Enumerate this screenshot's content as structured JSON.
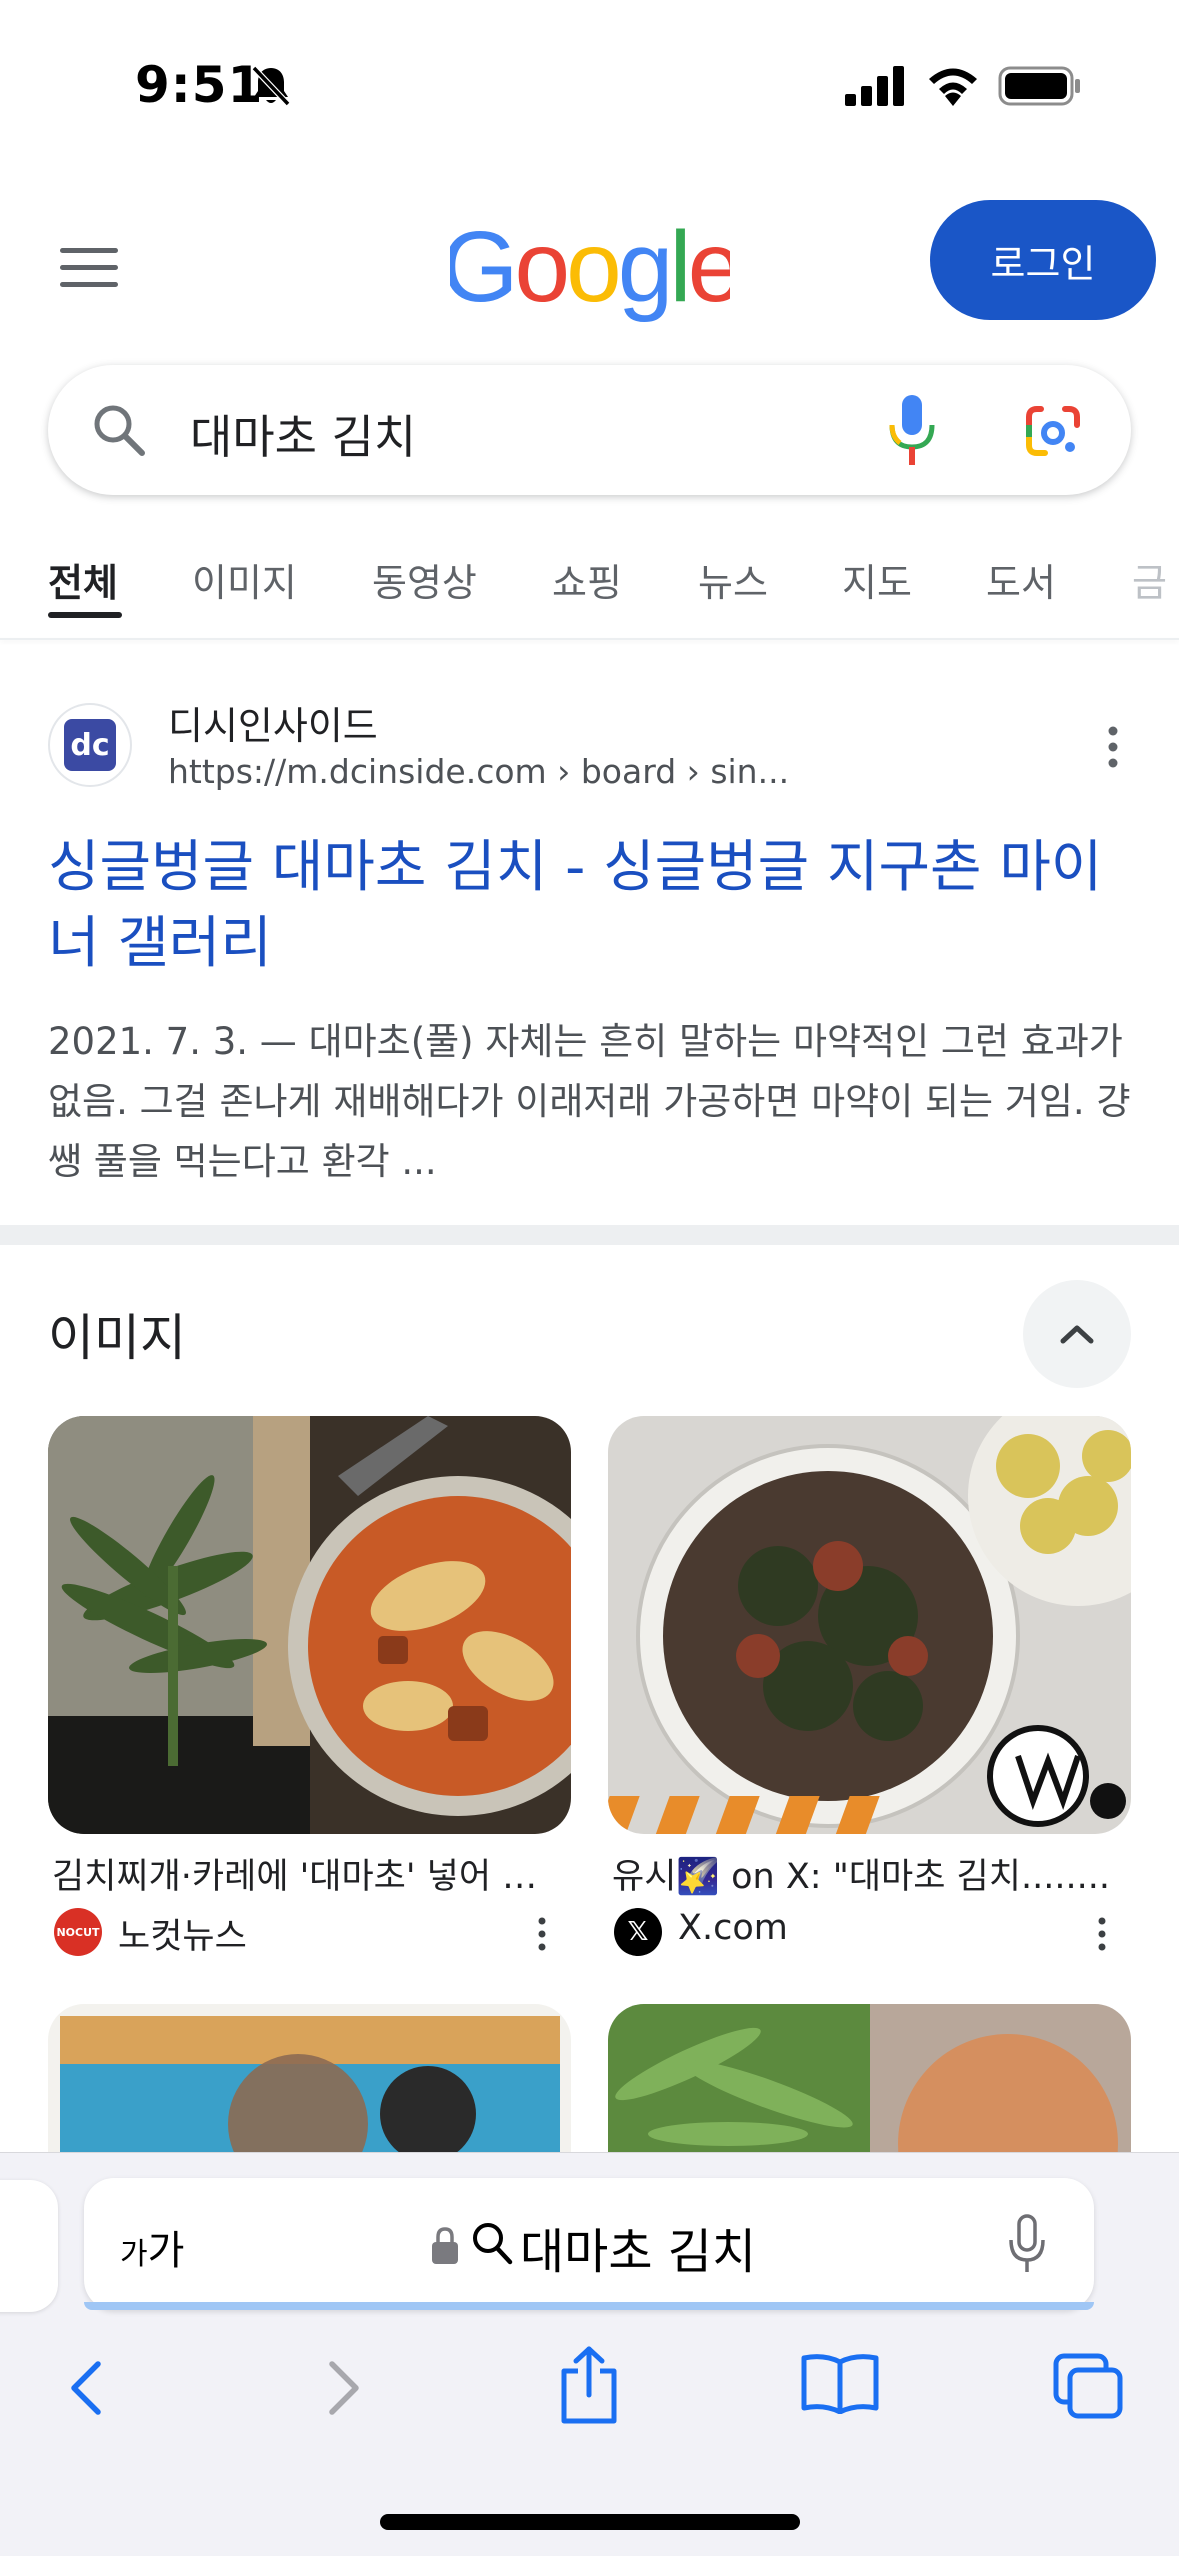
{
  "status": {
    "time": "9:51"
  },
  "header": {
    "logo_letters": [
      "G",
      "o",
      "o",
      "g",
      "l",
      "e"
    ],
    "logo_colors": [
      "#4285F4",
      "#EA4335",
      "#FBBC05",
      "#4285F4",
      "#34A853",
      "#EA4335"
    ],
    "login_label": "로그인"
  },
  "search": {
    "query": "대마초 김치"
  },
  "tabs": [
    "전체",
    "이미지",
    "동영상",
    "쇼핑",
    "뉴스",
    "지도",
    "도서",
    "금"
  ],
  "result": {
    "favicon_text": "dc",
    "site_name": "디시인사이드",
    "url": "https://m.dcinside.com › board › sin...",
    "title": "싱글벙글 대마초 김치 - 싱글벙글 지구촌 마이너 갤러리",
    "snippet": "2021. 7. 3. — 대마초(풀) 자체는 흔히 말하는 마약적인 그런 효과가 없음. 그걸 존나게 재배해다가 이래저래 가공하면 마약이 되는 거임. 걍 쌩 풀을 먹는다고 환각 ..."
  },
  "images_section": {
    "heading": "이미지",
    "cards": [
      {
        "caption": "김치찌개·카레에 '대마초' 넣어 먹...",
        "source": "노컷뉴스",
        "source_icon_text": "NOCUT"
      },
      {
        "caption": "유시🌠 on X: \"대마초 김치........",
        "source": "X.com",
        "source_icon_text": "𝕏"
      }
    ]
  },
  "safari": {
    "aa_small": "가",
    "aa_large": "가",
    "address_text": "대마초 김치"
  },
  "colors": {
    "accent_blue": "#1a56c7",
    "link_blue": "#1a4fc0"
  }
}
